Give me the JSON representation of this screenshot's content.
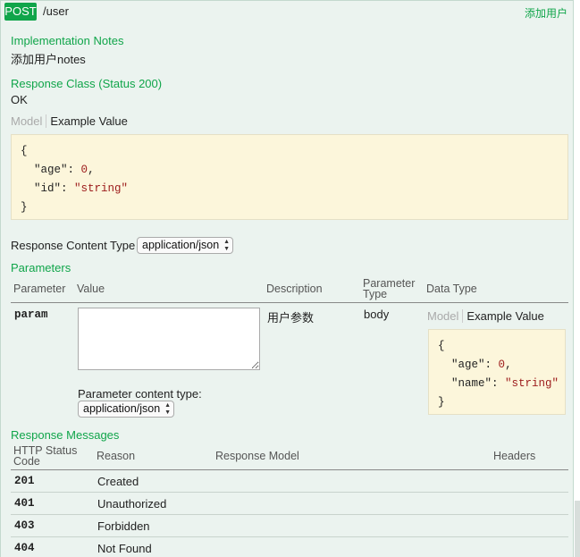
{
  "operation": {
    "method": "POST",
    "path": "/user",
    "summary": "添加用户"
  },
  "implementation": {
    "heading": "Implementation Notes",
    "notes": "添加用户notes"
  },
  "response_class": {
    "heading": "Response Class (Status 200)",
    "value": "OK",
    "tabs": {
      "model": "Model",
      "example": "Example Value"
    },
    "example": {
      "open": "{",
      "line1_key": "\"age\"",
      "line1_sep": ": ",
      "line1_val": "0",
      "line1_end": ",",
      "line2_key": "\"id\"",
      "line2_sep": ": ",
      "line2_val": "\"string\"",
      "close": "}"
    }
  },
  "response_content_type": {
    "label": "Response Content Type",
    "value": "application/json"
  },
  "parameters": {
    "heading": "Parameters",
    "headers": {
      "parameter": "Parameter",
      "value": "Value",
      "description": "Description",
      "parameter_type_1": "Parameter",
      "parameter_type_2": "Type",
      "data_type": "Data Type"
    },
    "rows": [
      {
        "name": "param",
        "value": "",
        "description": "用户参数",
        "type": "body",
        "content_type_label": "Parameter content type:",
        "content_type_value": "application/json",
        "tabs": {
          "model": "Model",
          "example": "Example Value"
        },
        "example": {
          "open": "{",
          "line1_key": "\"age\"",
          "line1_sep": ": ",
          "line1_val": "0",
          "line1_end": ",",
          "line2_key": "\"name\"",
          "line2_sep": ": ",
          "line2_val": "\"string\"",
          "close": "}"
        }
      }
    ]
  },
  "response_messages": {
    "heading": "Response Messages",
    "headers": {
      "http_status_1": "HTTP Status",
      "http_status_2": "Code",
      "reason": "Reason",
      "response_model": "Response Model",
      "headers": "Headers"
    },
    "rows": [
      {
        "code": "201",
        "reason": "Created"
      },
      {
        "code": "401",
        "reason": "Unauthorized"
      },
      {
        "code": "403",
        "reason": "Forbidden"
      },
      {
        "code": "404",
        "reason": "Not Found"
      }
    ]
  },
  "colors": {
    "accent": "#10a54a",
    "panel_bg": "#ebf3ef",
    "code_bg": "#fcf6db"
  }
}
